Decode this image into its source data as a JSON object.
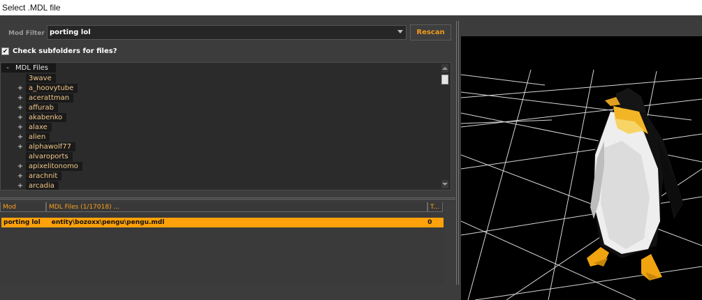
{
  "window": {
    "title": "Select .MDL file"
  },
  "filter": {
    "label": "Mod Filter",
    "value": "porting lol",
    "rescan_label": "Rescan"
  },
  "subfolders": {
    "label": "Check subfolders for files?",
    "checked": true,
    "checkmark": "✔"
  },
  "tree": {
    "root_expander": "-",
    "root_label": "MDL Files",
    "items": [
      {
        "expander": "",
        "label": "3wave"
      },
      {
        "expander": "+",
        "label": "a_hoovytube"
      },
      {
        "expander": "+",
        "label": "acerattman"
      },
      {
        "expander": "+",
        "label": "affurab"
      },
      {
        "expander": "+",
        "label": "akabenko"
      },
      {
        "expander": "+",
        "label": "alaxe"
      },
      {
        "expander": "+",
        "label": "alien"
      },
      {
        "expander": "+",
        "label": "alphawolf77"
      },
      {
        "expander": "",
        "label": "alvaroports"
      },
      {
        "expander": "+",
        "label": "apixelitonomo"
      },
      {
        "expander": "+",
        "label": "arachnit"
      },
      {
        "expander": "+",
        "label": "arcadia"
      }
    ]
  },
  "list": {
    "columns": [
      "Mod",
      "MDL Files (1/17018) ...",
      "T..."
    ],
    "rows": [
      {
        "mod": "porting lol",
        "path": "entity\\bozoxx\\pengu\\pengu.mdl",
        "t": "0"
      }
    ]
  },
  "colors": {
    "accent": "#ffa10a",
    "tree_text": "#f2c88a",
    "background": "#3c3c3c"
  },
  "viewport": {
    "subject": "penguin-model"
  }
}
